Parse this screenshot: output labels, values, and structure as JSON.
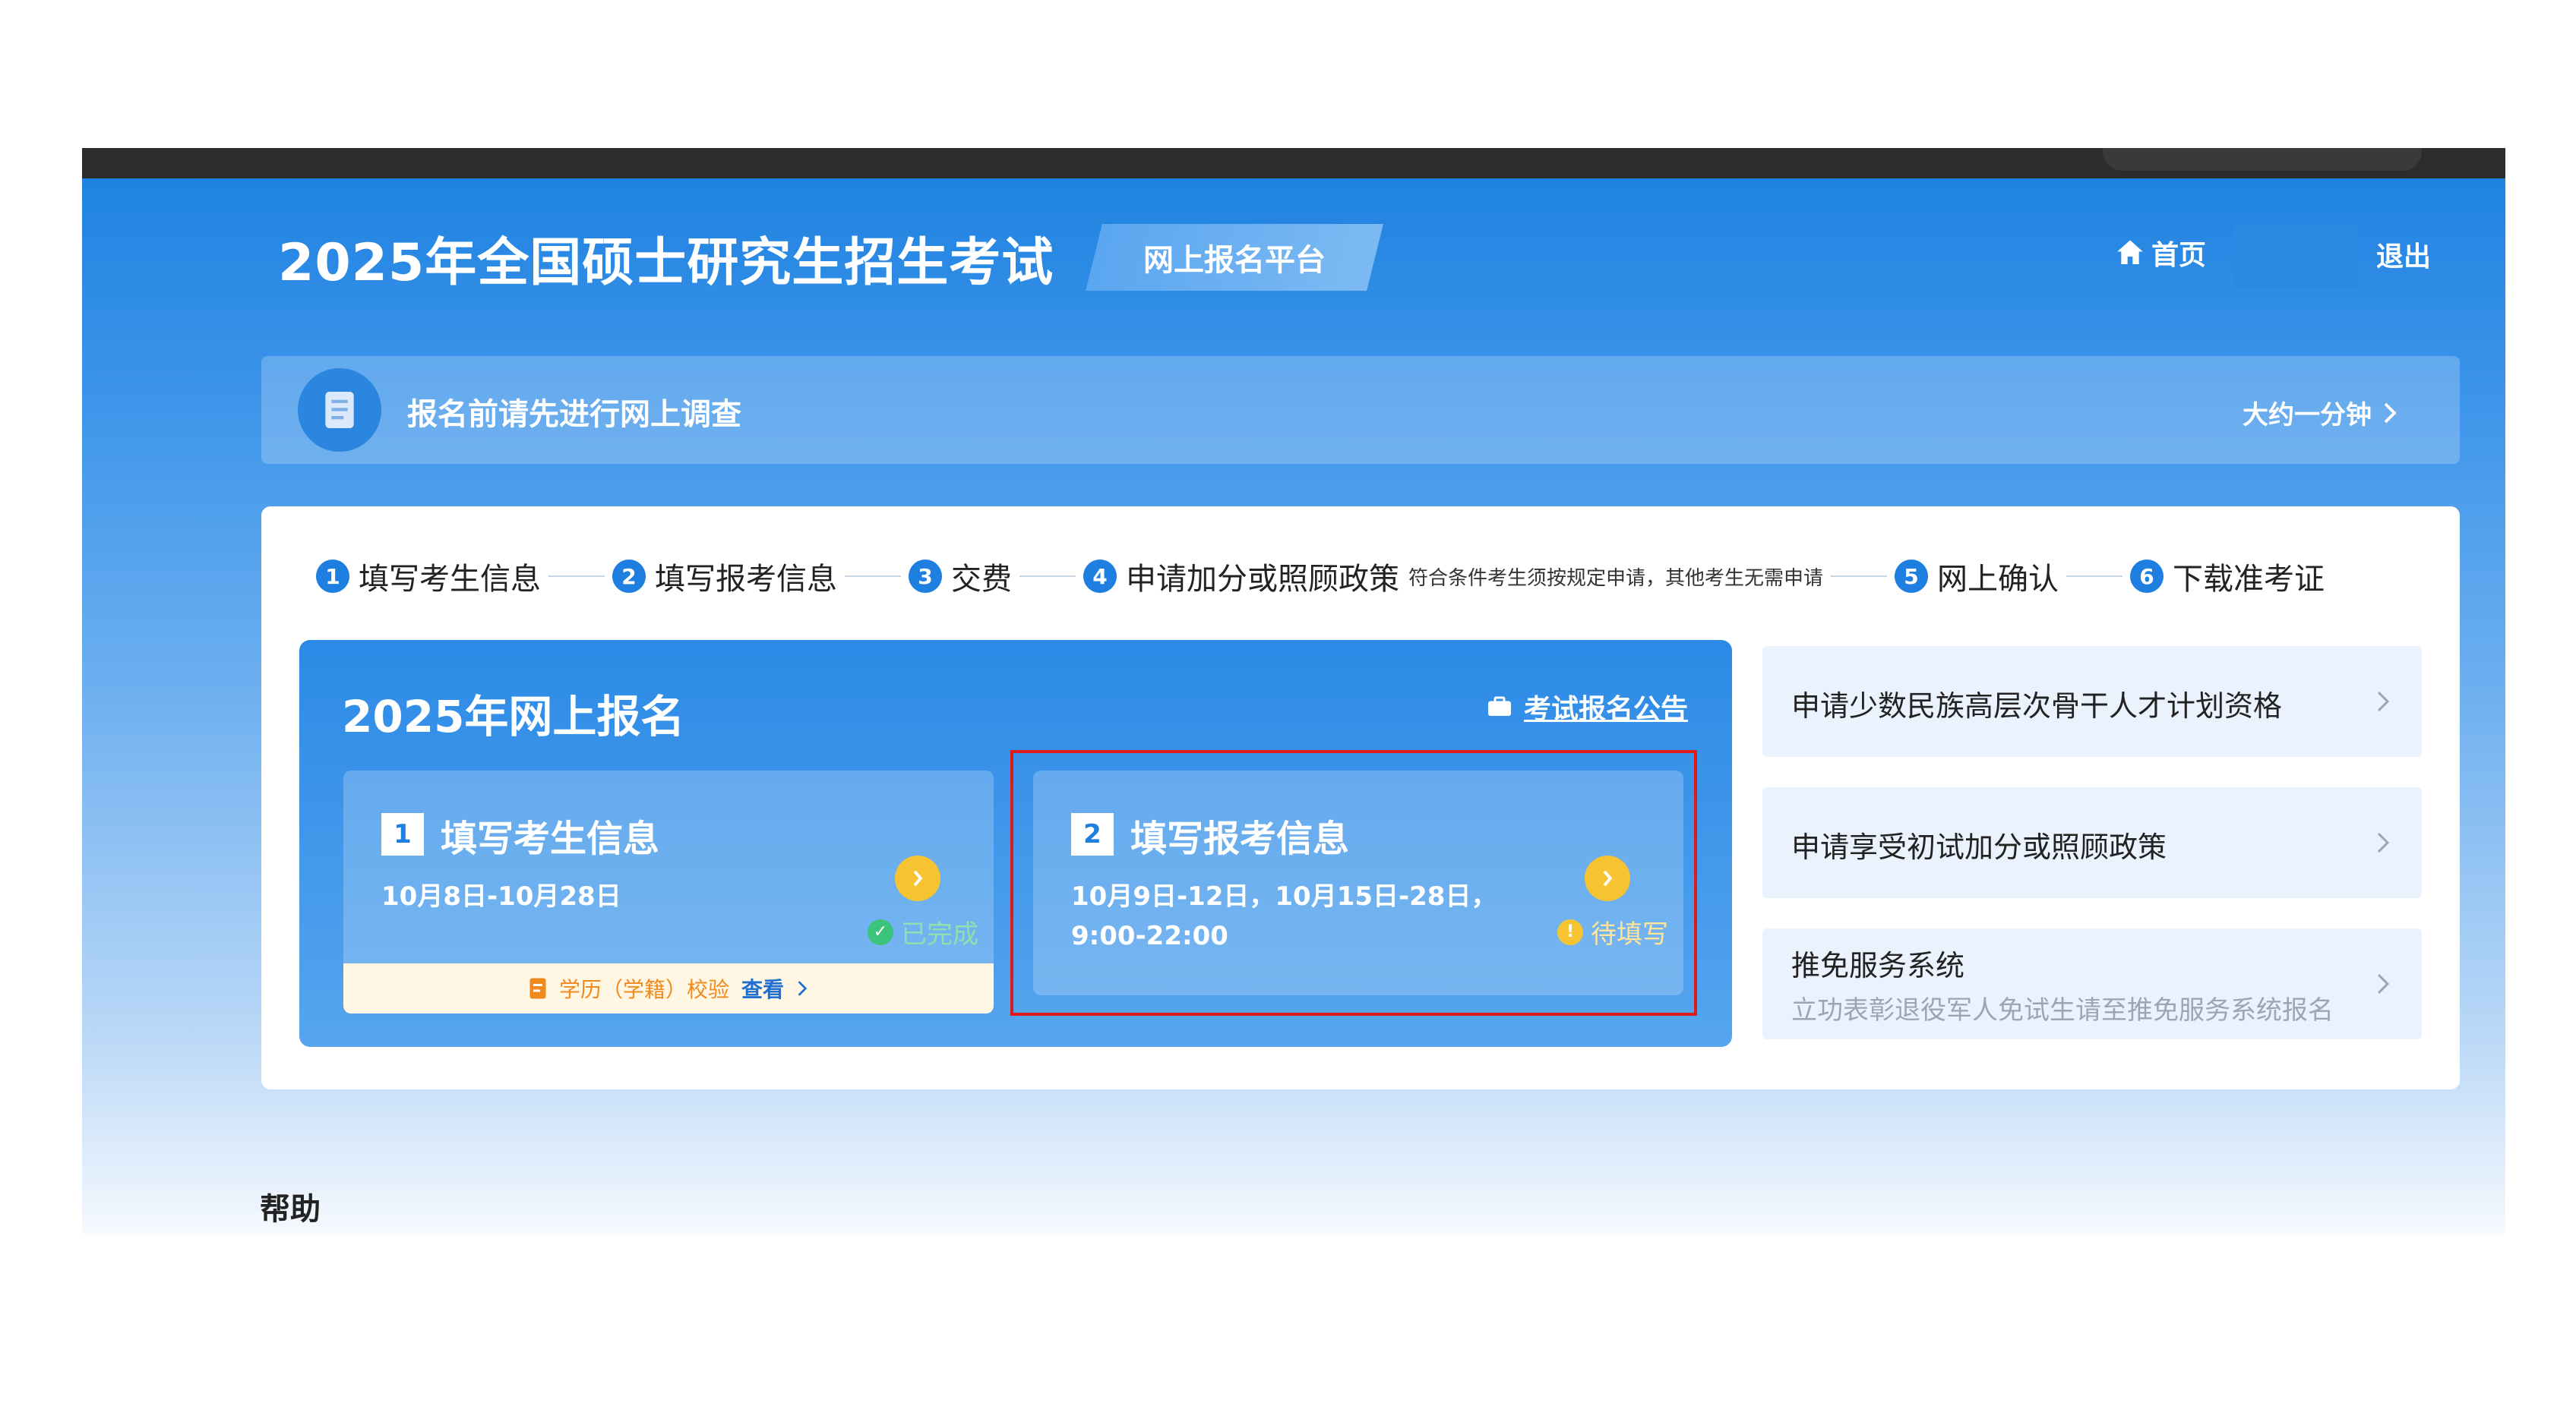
{
  "header": {
    "title": "2025年全国硕士研究生招生考试",
    "platform": "网上报名平台",
    "home": "首页",
    "logout": "退出"
  },
  "survey": {
    "text": "报名前请先进行网上调查",
    "duration": "大约一分钟"
  },
  "steps": [
    {
      "num": "1",
      "label": "填写考生信息"
    },
    {
      "num": "2",
      "label": "填写报考信息"
    },
    {
      "num": "3",
      "label": "交费"
    },
    {
      "num": "4",
      "label": "申请加分或照顾政策",
      "note": "符合条件考生须按规定申请，其他考生无需申请"
    },
    {
      "num": "5",
      "label": "网上确认"
    },
    {
      "num": "6",
      "label": "下载准考证"
    }
  ],
  "main": {
    "title": "2025年网上报名",
    "notice_link": "考试报名公告",
    "cards": [
      {
        "num": "1",
        "title": "填写考生信息",
        "date_line1": "10月8日-10月28日",
        "date_line2": "",
        "status": "已完成",
        "footer_label": "学历（学籍）校验",
        "footer_action": "查看"
      },
      {
        "num": "2",
        "title": "填写报考信息",
        "date_line1": "10月9日-12日，10月15日-28日，",
        "date_line2": "9:00-22:00",
        "status": "待填写"
      }
    ]
  },
  "side": [
    {
      "title": "申请少数民族高层次骨干人才计划资格"
    },
    {
      "title": "申请享受初试加分或照顾政策"
    },
    {
      "title": "推免服务系统",
      "subtitle": "立功表彰退役军人免试生请至推免服务系统报名"
    }
  ],
  "help": "帮助",
  "colors": {
    "brand": "#1e7fe0",
    "highlight": "#e01a1a",
    "done": "#8de0b0",
    "pending": "#f5c430"
  }
}
